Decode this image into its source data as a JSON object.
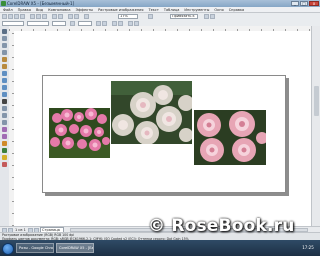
{
  "window": {
    "title": "CorelDRAW X5 - [Безымянный-1]",
    "minimize_label": "_",
    "maximize_label": "□",
    "close_label": "x"
  },
  "menu": [
    "Файл",
    "Правка",
    "Вид",
    "Компоновка",
    "Эффекты",
    "Растровые изображения",
    "Текст",
    "Таблица",
    "Инструменты",
    "Окно",
    "Справка"
  ],
  "toolbar": {
    "zoom_value": "17%",
    "snap_label": "Привязать к"
  },
  "pagebar": {
    "page_counter": "1 из 1",
    "page_tab": "Страница 1"
  },
  "status": {
    "line1": "Растровое изображение (RGB) RGB 100 dpi",
    "line2": "Профиль цветов документа: RGB: sRGB IEC61966-2.1; CMYK: ISO Coated v2 (ECI); Оттенки серого: Dot Gain 15%"
  },
  "taskbar": {
    "items": [
      "Розы - Google Chrome",
      "CorelDRAW X5 - [Без..."
    ],
    "clock": "17:25"
  },
  "watermark": "© RoseBook.ru",
  "colors": {
    "selection_accent": "#3a7bd5",
    "taskbar": "#2f4b66"
  },
  "icons": [
    "corel-logo-icon",
    "new-document-icon",
    "open-icon",
    "save-icon",
    "print-icon",
    "pick-tool-icon",
    "zoom-tool-icon",
    "rectangle-tool-icon",
    "ellipse-tool-icon",
    "text-tool-icon",
    "windows-start-icon"
  ]
}
